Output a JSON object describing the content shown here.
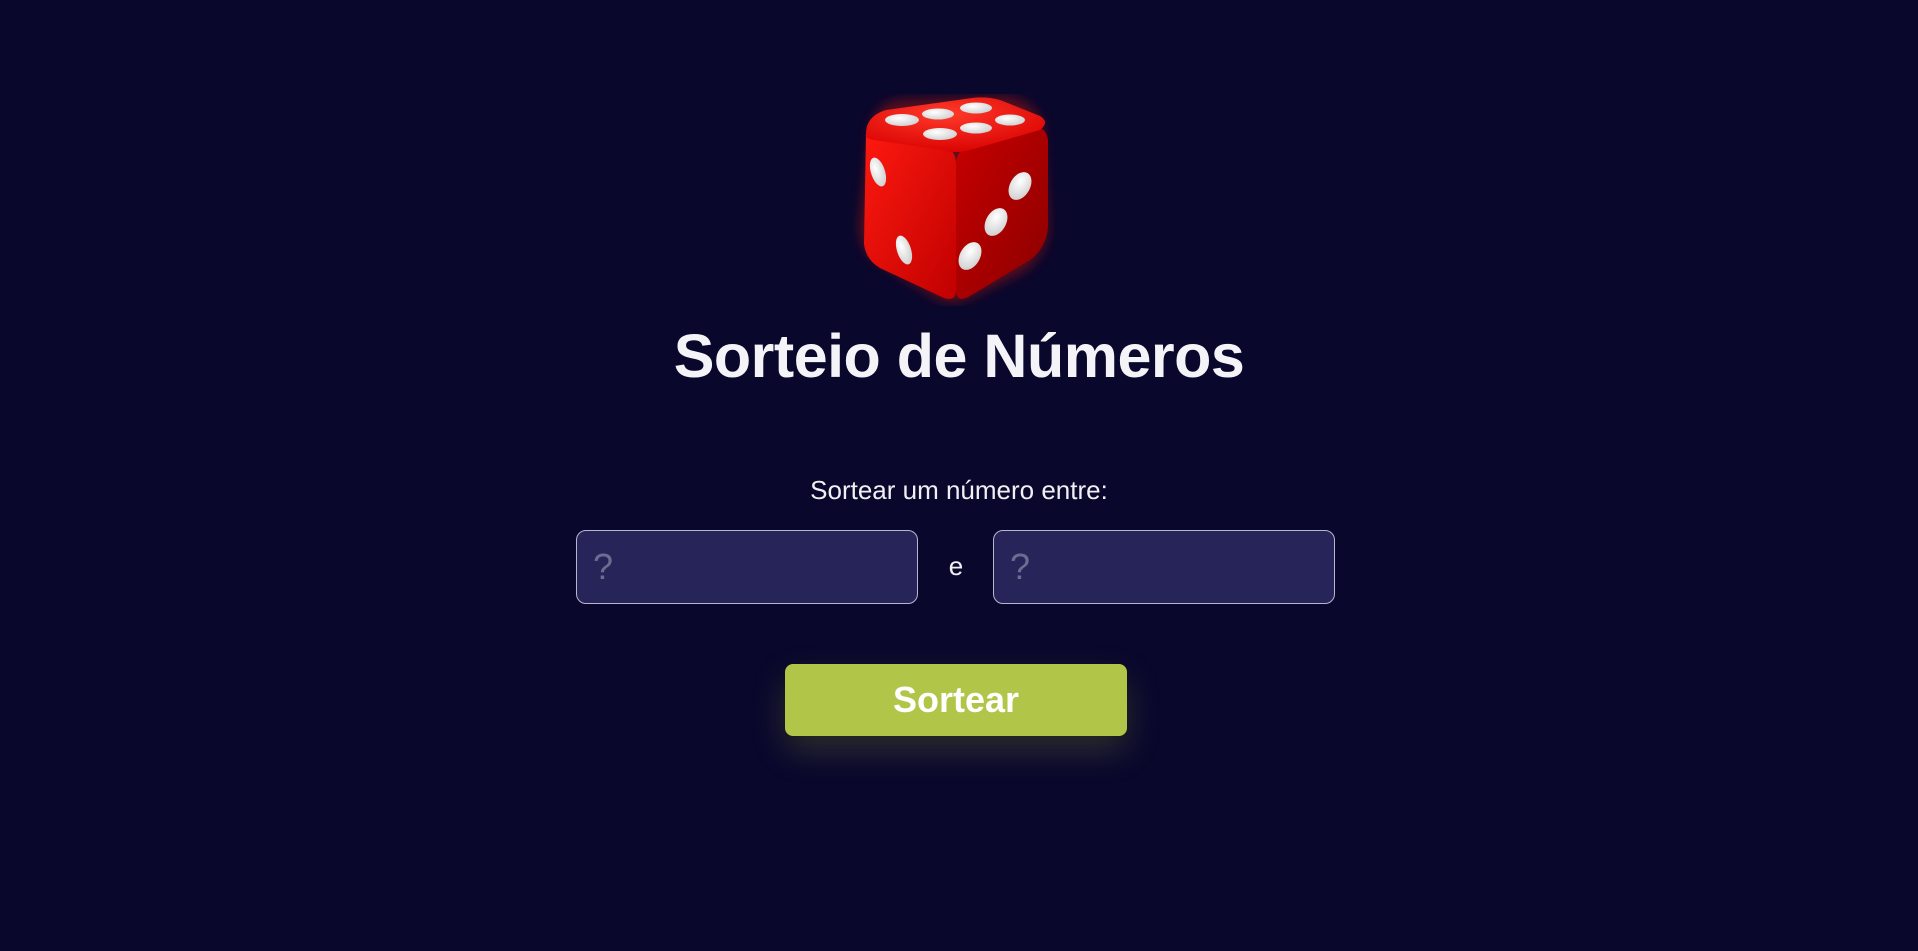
{
  "app": {
    "title": "Sorteio de Números",
    "logo_icon": "red-dice-icon"
  },
  "form": {
    "prompt": "Sortear um número entre:",
    "min_field": {
      "value": "",
      "placeholder": "?"
    },
    "connector": "e",
    "max_field": {
      "value": "",
      "placeholder": "?"
    },
    "submit_label": "Sortear"
  },
  "colors": {
    "background": "#09072c",
    "field_background": "#27245a",
    "field_border": "#b8b6cf",
    "button": "#b1c548",
    "dice": "#e00000"
  }
}
